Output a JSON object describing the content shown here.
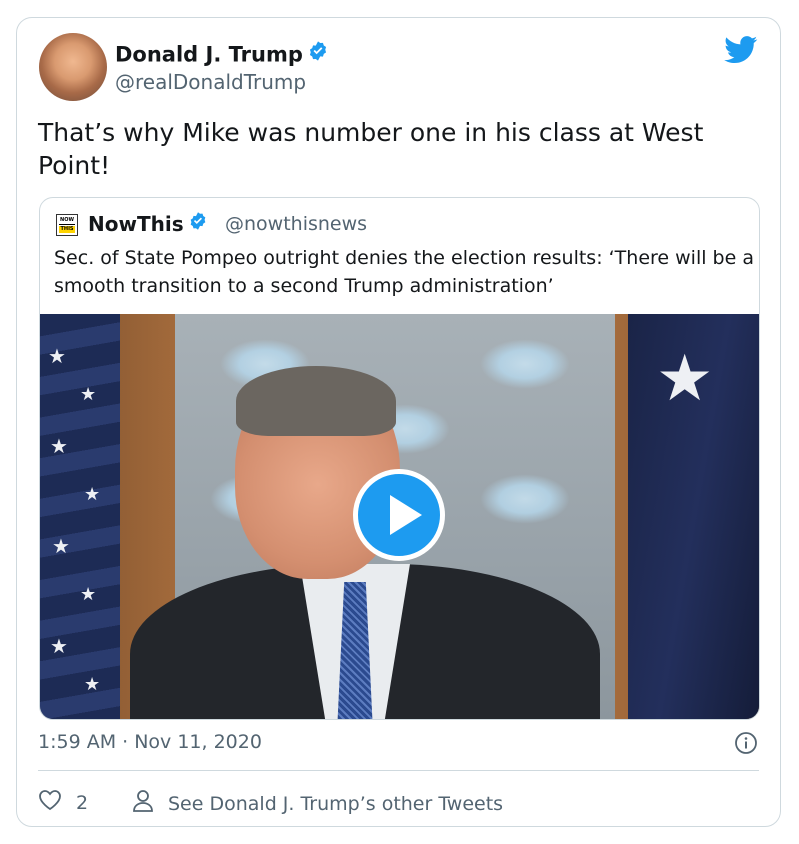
{
  "author": {
    "name": "Donald J. Trump",
    "handle": "@realDonaldTrump"
  },
  "tweet": {
    "text": "That’s why Mike was number one in his class at West Point!",
    "timestamp": "1:59 AM · Nov 11, 2020",
    "likes": "2",
    "other_tweets_label": "See Donald J. Trump’s other Tweets"
  },
  "quoted": {
    "logo_top": "NOW",
    "logo_bottom": "THIS",
    "name": "NowThis",
    "handle": "@nowthisnews",
    "text": "Sec. of State Pompeo outright denies the election results: ‘There will be a smooth transition to a second Trump administration’"
  },
  "colors": {
    "accent": "#1d9bf0",
    "secondary_text": "#536471",
    "border": "#cfd9de"
  },
  "icons": [
    "verified-badge-icon",
    "twitter-bird-icon",
    "play-icon",
    "info-icon",
    "heart-icon",
    "person-icon"
  ]
}
